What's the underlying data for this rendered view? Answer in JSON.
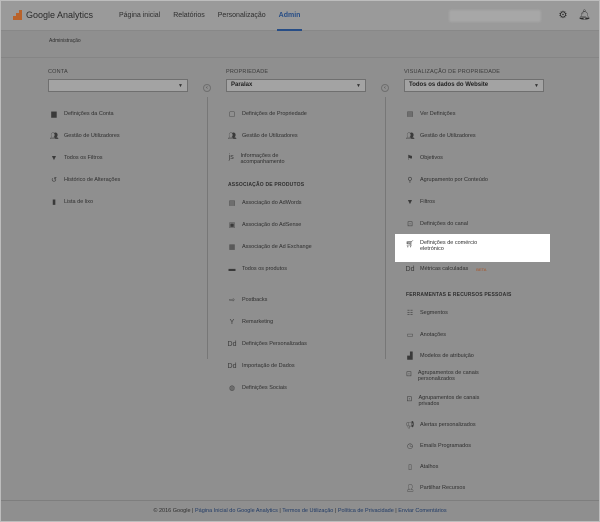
{
  "app": {
    "name": "Google Analytics"
  },
  "nav": {
    "items": [
      "Página inicial",
      "Relatórios",
      "Personalização",
      "Admin"
    ],
    "active": "Admin"
  },
  "breadcrumb": "Administração",
  "conta": {
    "label": "CONTA",
    "select_value": "",
    "items": [
      "Definições da Conta",
      "Gestão de Utilizadores",
      "Todos os Filtros",
      "Histórico de Alterações",
      "Lista de lixo"
    ]
  },
  "propriedade": {
    "label": "PROPRIEDADE",
    "select_value": "Paralax",
    "items": [
      "Definições de Propriedade",
      "Gestão de Utilizadores",
      "Informações de acompanhamento"
    ],
    "section_label": "ASSOCIAÇÃO DE PRODUTOS",
    "product_items": [
      "Associação do AdWords",
      "Associação do AdSense",
      "Associação de Ad Exchange",
      "Todos os produtos"
    ],
    "other_items": [
      "Postbacks",
      "Remarketing",
      "Definições Personalizadas",
      "Importação de Dados",
      "Definições Sociais"
    ]
  },
  "vista": {
    "label": "VISUALIZAÇÃO DE PROPRIEDADE",
    "select_value": "Todos os dados do Website",
    "items": [
      "Ver Definições",
      "Gestão de Utilizadores",
      "Objetivos",
      "Agrupamento por Conteúdo",
      "Filtros",
      "Definições do canal",
      "Definições de comércio eletrónico",
      "Métricas calculadas"
    ],
    "beta": "BETA",
    "section_label": "FERRAMENTAS E RECURSOS PESSOAIS",
    "tool_items": [
      "Segmentos",
      "Anotações",
      "Modelos de atribuição",
      "Agrupamentos de canais personalizados",
      "Agrupamentos de canais privados",
      "Alertas personalizados",
      "Emails Programados",
      "Atalhos",
      "Partilhar Recursos"
    ]
  },
  "footer": {
    "copyright": "© 2016 Google",
    "links": [
      "Página Inicial do Google Analytics",
      "Termos de Utilização",
      "Política de Privacidade",
      "Enviar Comentários"
    ]
  }
}
